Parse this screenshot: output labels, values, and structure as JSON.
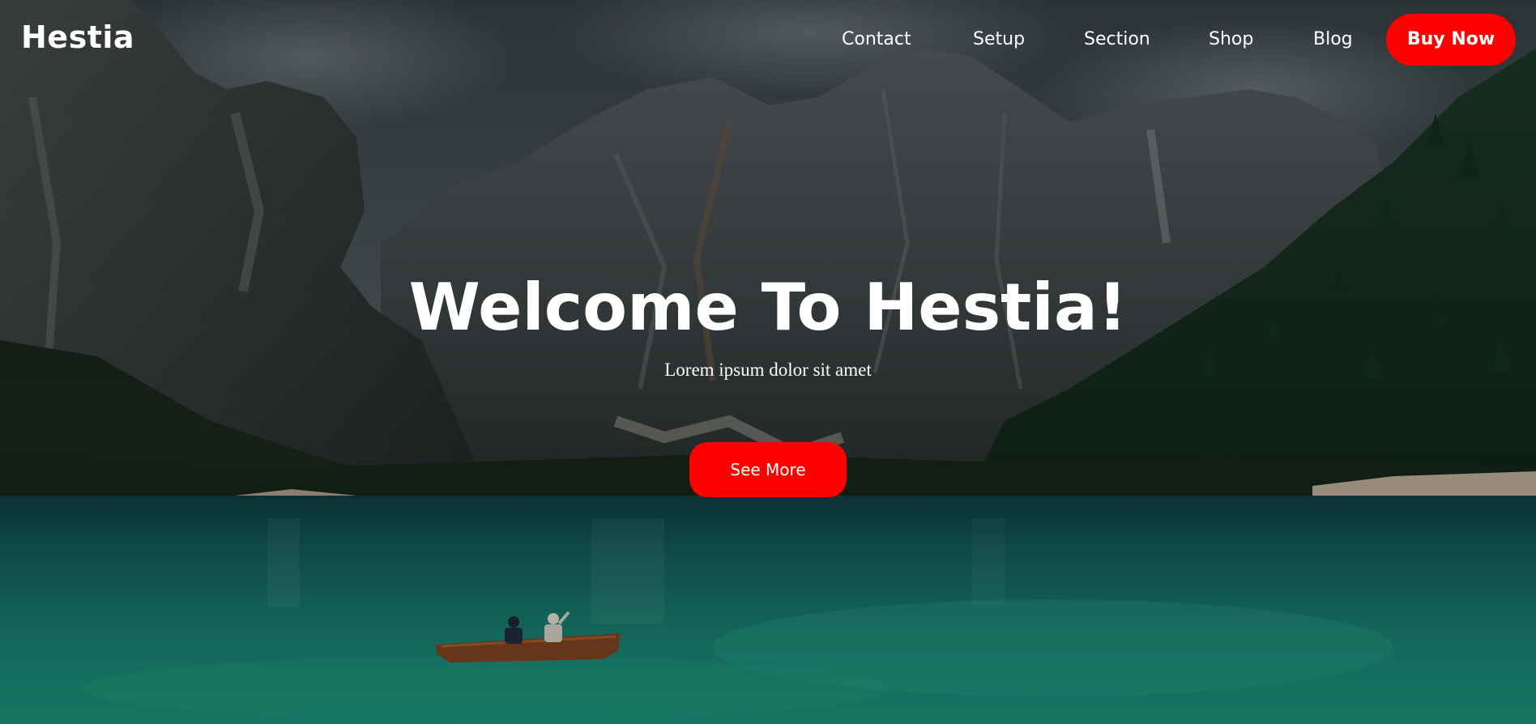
{
  "header": {
    "brand": "Hestia",
    "nav": [
      {
        "label": "Contact"
      },
      {
        "label": "Setup"
      },
      {
        "label": "Section"
      },
      {
        "label": "Shop"
      },
      {
        "label": "Blog"
      }
    ],
    "cta_label": "Buy Now"
  },
  "hero": {
    "title": "Welcome To Hestia!",
    "subtitle": "Lorem ipsum dolor sit amet",
    "button_label": "See More"
  },
  "colors": {
    "accent": "#ff0000",
    "text": "#ffffff",
    "water": "#1b7a6c",
    "sky": "#3b474c"
  }
}
